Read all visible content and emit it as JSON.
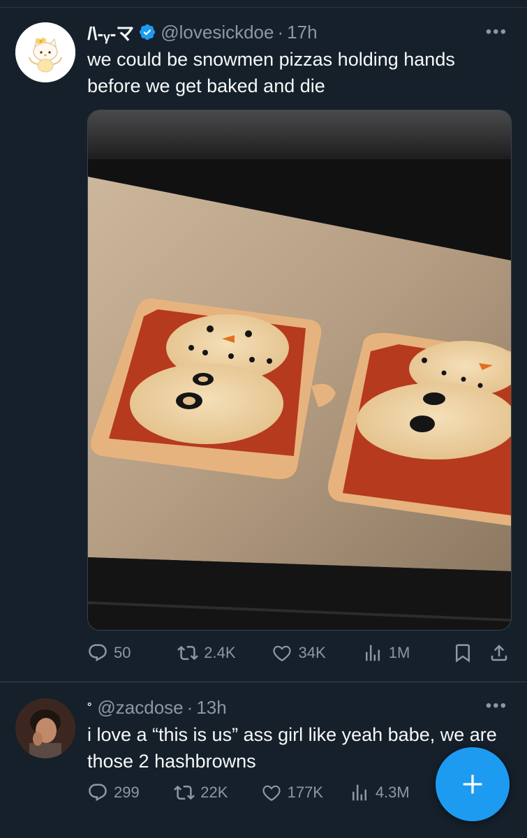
{
  "tweets": [
    {
      "display_name": "/\\-ᵧ-マ",
      "handle": "@lovesickdoe",
      "separator": "·",
      "time": "17h",
      "text": "we could be snowmen pizzas holding hands before we get baked and die",
      "verified": true,
      "more_icon": "more-icon",
      "stats": {
        "replies": "50",
        "retweets": "2.4K",
        "likes": "34K",
        "views": "1M"
      }
    },
    {
      "display_name": "°",
      "handle": "@zacdose",
      "separator": "·",
      "time": "13h",
      "text": "i love a “this is us” ass girl like yeah babe, we are those 2 hashbrowns",
      "verified": false,
      "more_icon": "more-icon",
      "stats": {
        "replies": "299",
        "retweets": "22K",
        "likes": "177K",
        "views": "4.3M"
      }
    }
  ],
  "icons": {
    "reply": "reply-icon",
    "retweet": "retweet-icon",
    "like": "heart-icon",
    "views": "views-icon",
    "bookmark": "bookmark-icon",
    "share": "share-icon",
    "verified": "verified-badge-icon",
    "compose": "plus-icon"
  },
  "colors": {
    "background": "#15202b",
    "text": "#f7f9f9",
    "secondary": "#8b98a5",
    "accent": "#1d9bf0",
    "divider": "#38444d"
  }
}
